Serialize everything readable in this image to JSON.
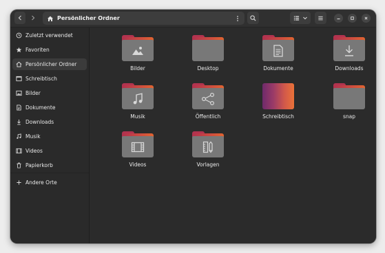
{
  "header": {
    "path_title": "Persönlicher Ordner"
  },
  "sidebar": {
    "items": [
      {
        "label": "Zuletzt verwendet",
        "icon": "clock-icon"
      },
      {
        "label": "Favoriten",
        "icon": "star-icon"
      },
      {
        "label": "Persönlicher Ordner",
        "icon": "home-icon",
        "active": true
      },
      {
        "label": "Schreibtisch",
        "icon": "desktop-icon"
      },
      {
        "label": "Bilder",
        "icon": "image-icon"
      },
      {
        "label": "Dokumente",
        "icon": "document-icon"
      },
      {
        "label": "Downloads",
        "icon": "download-icon"
      },
      {
        "label": "Musik",
        "icon": "music-icon"
      },
      {
        "label": "Videos",
        "icon": "video-icon"
      },
      {
        "label": "Papierkorb",
        "icon": "trash-icon"
      },
      {
        "label": "Andere Orte",
        "icon": "plus-icon"
      }
    ]
  },
  "folders": [
    {
      "label": "Bilder",
      "icon": "image-icon"
    },
    {
      "label": "Desktop",
      "icon": "none"
    },
    {
      "label": "Dokumente",
      "icon": "document-icon"
    },
    {
      "label": "Downloads",
      "icon": "download-icon"
    },
    {
      "label": "Musik",
      "icon": "music-icon"
    },
    {
      "label": "Öffentlich",
      "icon": "share-icon"
    },
    {
      "label": "Schreibtisch",
      "icon": "desktop-folder"
    },
    {
      "label": "snap",
      "icon": "none"
    },
    {
      "label": "Videos",
      "icon": "video-icon"
    },
    {
      "label": "Vorlagen",
      "icon": "template-icon"
    }
  ],
  "colors": {
    "accent_folder_top": "#c0384a",
    "window_bg": "#2b2b2b",
    "sidebar_bg": "#2a2a2a"
  }
}
